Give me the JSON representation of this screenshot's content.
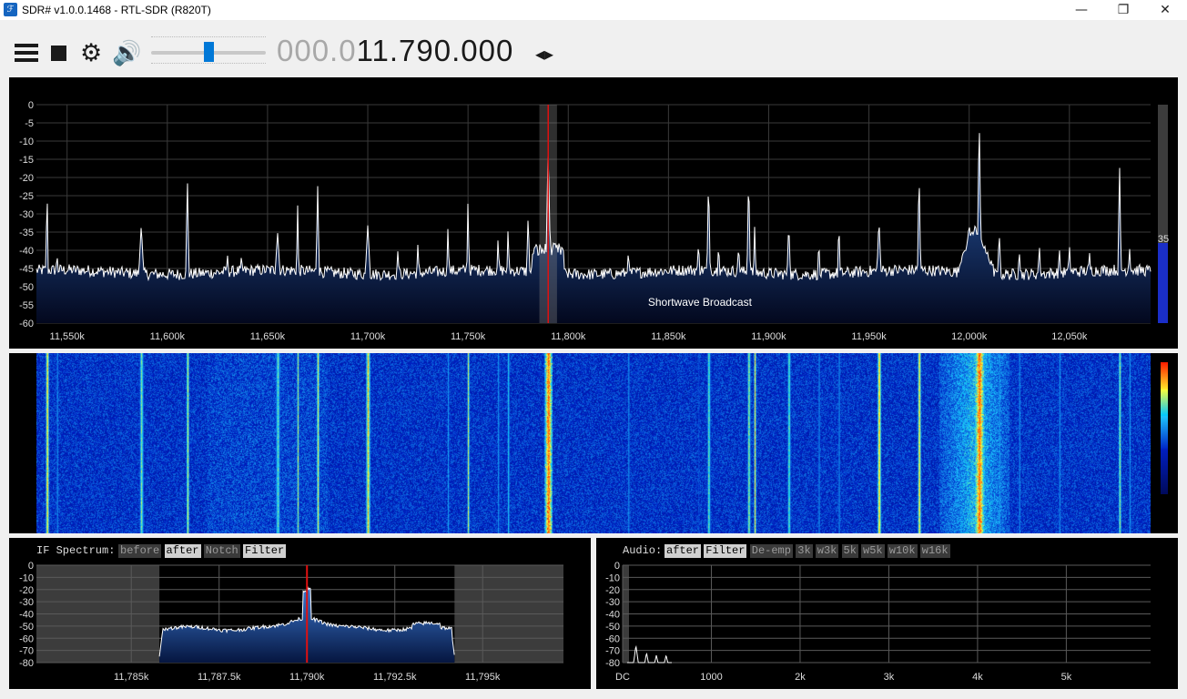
{
  "window": {
    "title": "SDR# v1.0.0.1468 - RTL-SDR (R820T)",
    "icon": "sdrsharp-logo-icon",
    "minimize_glyph": "—",
    "maximize_glyph": "❐",
    "close_glyph": "✕"
  },
  "toolbar": {
    "menu_icon": "hamburger-menu-icon",
    "stop_icon": "stop-icon",
    "settings_glyph": "⚙",
    "audio_glyph": "🔊",
    "volume_level": 0.5,
    "frequency_dim": "000.0",
    "frequency_main": "11.790.000",
    "tuning_step_glyph": "◂▸"
  },
  "main_spectrum": {
    "y_ticks": [
      "0",
      "-5",
      "-10",
      "-15",
      "-20",
      "-25",
      "-30",
      "-35",
      "-40",
      "-45",
      "-50",
      "-55",
      "-60"
    ],
    "x_ticks": [
      "11,550k",
      "11,600k",
      "11,650k",
      "11,700k",
      "11,750k",
      "11,800k",
      "11,850k",
      "11,900k",
      "11,950k",
      "12,000k",
      "12,050k"
    ],
    "band_label": "Shortwave Broadcast",
    "contrast_value": "35",
    "tuned_khz": 11790,
    "colors": {
      "trace": "#ffffff",
      "fill_top": "#2d63b8",
      "band": "#0a14a8",
      "marker": "#e01010"
    }
  },
  "if_spectrum": {
    "label": "IF Spectrum:",
    "buttons": [
      {
        "label": "before",
        "active": false
      },
      {
        "label": "after",
        "active": true
      },
      {
        "label": "Notch",
        "active": false
      },
      {
        "label": "Filter",
        "active": true
      }
    ],
    "y_ticks": [
      "0",
      "-10",
      "-20",
      "-30",
      "-40",
      "-50",
      "-60",
      "-70",
      "-80"
    ],
    "x_ticks": [
      "11,785k",
      "11,787.5k",
      "11,790k",
      "11,792.5k",
      "11,795k"
    ]
  },
  "audio_spectrum": {
    "label": "Audio:",
    "buttons": [
      {
        "label": "after",
        "active": true
      },
      {
        "label": "Filter",
        "active": true
      },
      {
        "label": "De-emp",
        "active": false
      },
      {
        "label": "3k",
        "active": false
      },
      {
        "label": "w3k",
        "active": false
      },
      {
        "label": "5k",
        "active": false
      },
      {
        "label": "w5k",
        "active": false
      },
      {
        "label": "w10k",
        "active": false
      },
      {
        "label": "w16k",
        "active": false
      }
    ],
    "y_ticks": [
      "0",
      "-10",
      "-20",
      "-30",
      "-40",
      "-50",
      "-60",
      "-70",
      "-80"
    ],
    "x_ticks": [
      "DC",
      "1000",
      "2k",
      "3k",
      "4k",
      "5k"
    ]
  }
}
